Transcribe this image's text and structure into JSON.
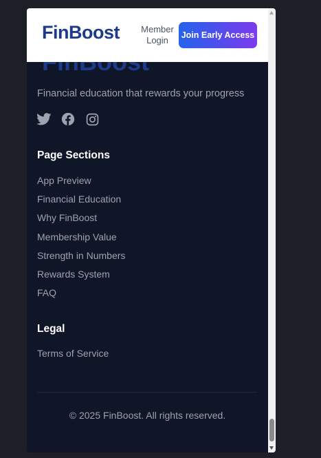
{
  "header": {
    "logo_text": "FinBoost",
    "member_login": "Member Login",
    "cta_label": "Join Early Access"
  },
  "footer": {
    "logo_text": "FinBoost",
    "tagline": "Financial education that rewards your progress",
    "socials": [
      "twitter-icon",
      "facebook-icon",
      "instagram-icon"
    ],
    "page_sections_title": "Page Sections",
    "page_sections": [
      "App Preview",
      "Financial Education",
      "Why FinBoost",
      "Membership Value",
      "Strength in Numbers",
      "Rewards System",
      "FAQ"
    ],
    "legal_title": "Legal",
    "legal_links": [
      "Terms of Service"
    ],
    "copyright": "© 2025 FinBoost. All rights reserved."
  },
  "colors": {
    "background": "#0e1628",
    "header_bg": "#ffffff",
    "logo": "#1e3a8a",
    "cta_gradient_start": "#2563eb",
    "cta_gradient_end": "#7c3aed",
    "text_muted": "#9ca3af",
    "heading": "#ffffff"
  }
}
